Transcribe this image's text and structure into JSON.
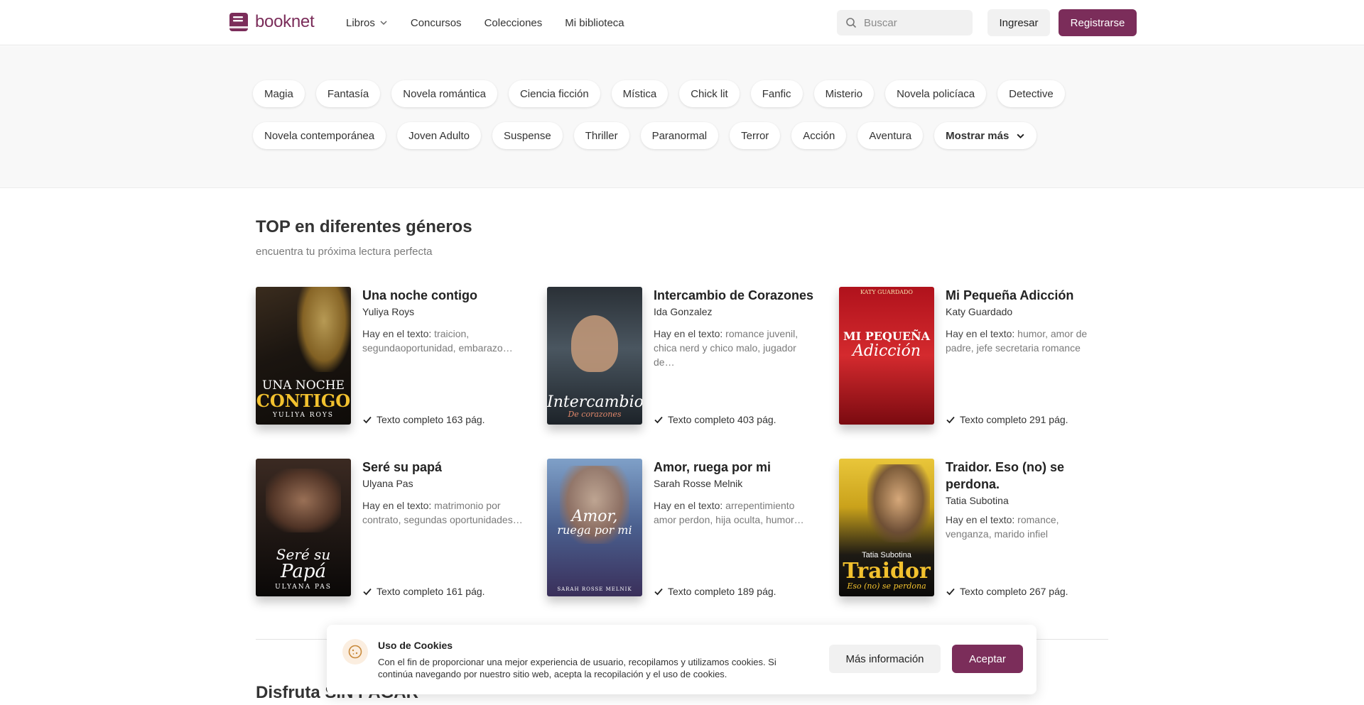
{
  "brand": {
    "name": "booknet",
    "color": "#7b2d5a"
  },
  "nav": {
    "books": "Libros",
    "contests": "Concursos",
    "collections": "Colecciones",
    "library": "Mi biblioteca"
  },
  "search": {
    "placeholder": "Buscar"
  },
  "auth": {
    "login": "Ingresar",
    "register": "Registrarse"
  },
  "genres": {
    "row1": [
      "Magia",
      "Fantasía",
      "Novela romántica",
      "Ciencia ficción",
      "Mística",
      "Chick lit",
      "Fanfic",
      "Misterio",
      "Novela policíaca",
      "Detective"
    ],
    "row2": [
      "Novela contemporánea",
      "Joven Adulto",
      "Suspense",
      "Thriller",
      "Paranormal",
      "Terror",
      "Acción",
      "Aventura"
    ],
    "more": "Mostrar más"
  },
  "top": {
    "title": "TOP en diferentes géneros",
    "subtitle": "encuentra tu próxima lectura perfecta",
    "tags_label": "Hay en el texto: ",
    "books": [
      {
        "title": "Una noche contigo",
        "author": "Yuliya Roys",
        "tags": "traicion, segundaoportunidad, embarazo…",
        "status": "Texto completo 163 pág.",
        "cover_text": "UNA NOCHE",
        "cover_text2": "CONTIGO",
        "cover_author": "YULIYA ROYS"
      },
      {
        "title": "Intercambio de Corazones",
        "author": "Ida Gonzalez",
        "tags": "romance juvenil, chica nerd y chico malo, jugador de…",
        "status": "Texto completo 403 pág.",
        "cover_text": "Intercambio",
        "cover_text2": "De corazones"
      },
      {
        "title": "Mi Pequeña Adicción",
        "author": "Katy Guardado",
        "tags": "humor, amor de padre, jefe secretaria romance",
        "status": "Texto completo 291 pág.",
        "cover_author": "KATY GUARDADO",
        "cover_text": "MI PEQUEÑA",
        "cover_text2": "Adicción"
      },
      {
        "title": "Seré su papá",
        "author": "Ulyana Pas",
        "tags": "matrimonio por contrato, segundas oportunidades…",
        "status": "Texto completo 161 pág.",
        "cover_text": "Seré su",
        "cover_text2": "Papá",
        "cover_author": "ULYANA PAS"
      },
      {
        "title": "Amor, ruega por mi",
        "author": "Sarah Rosse Melnik",
        "tags": "arrepentimiento amor perdon, hija oculta, humor…",
        "status": "Texto completo 189 pág.",
        "cover_text": "Amor,",
        "cover_text2": "ruega por mi",
        "cover_author": "SARAH ROSSE MELNIK"
      },
      {
        "title": "Traidor. Eso (no) se perdona.",
        "author": "Tatia Subotina",
        "tags": "romance, venganza, marido infiel",
        "status": "Texto completo 267 pág.",
        "cover_author": "Tatia Subotina",
        "cover_text": "Traidor",
        "cover_text2": "Eso (no) se perdona"
      }
    ]
  },
  "free": {
    "title": "Disfruta SIN PAGAR"
  },
  "cookies": {
    "title": "Uso de Cookies",
    "text": "Con el fin de proporcionar una mejor experiencia de usuario, recopilamos y utilizamos cookies. Si continúa navegando por nuestro sitio web, acepta la recopilación y el uso de cookies.",
    "more": "Más información",
    "accept": "Aceptar"
  }
}
